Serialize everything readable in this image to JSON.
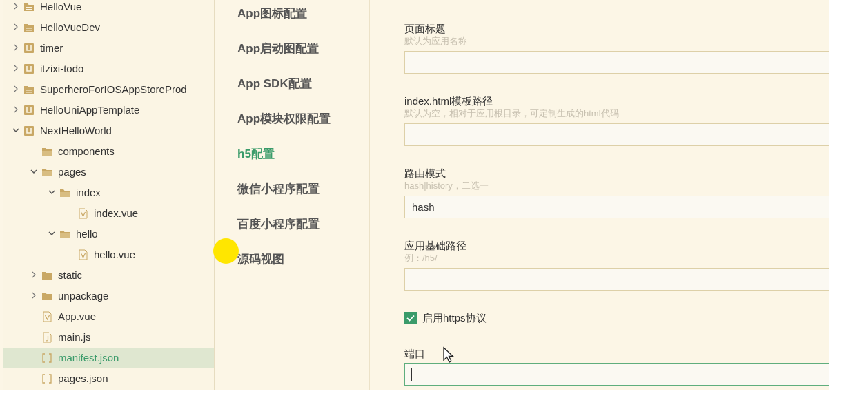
{
  "file_tree": [
    {
      "name": "HelloVue",
      "kind": "folder-lined",
      "expanded": false,
      "selected": false
    },
    {
      "name": "HelloVueDev",
      "kind": "folder-lined",
      "expanded": false,
      "selected": false
    },
    {
      "name": "timer",
      "kind": "project",
      "expanded": false,
      "selected": false
    },
    {
      "name": "itzixi-todo",
      "kind": "project",
      "expanded": false,
      "selected": false
    },
    {
      "name": "SuperheroForIOSAppStoreProd",
      "kind": "folder-lined",
      "expanded": false,
      "selected": false
    },
    {
      "name": "HelloUniAppTemplate",
      "kind": "project",
      "expanded": false,
      "selected": false
    },
    {
      "name": "NextHelloWorld",
      "kind": "project",
      "expanded": true,
      "selected": false,
      "children": [
        {
          "name": "components",
          "kind": "folder-open",
          "selected": false
        },
        {
          "name": "pages",
          "kind": "folder-open",
          "expanded": true,
          "selected": false,
          "children": [
            {
              "name": "index",
              "kind": "folder-open",
              "expanded": true,
              "selected": false,
              "children": [
                {
                  "name": "index.vue",
                  "kind": "vue",
                  "selected": false
                }
              ]
            },
            {
              "name": "hello",
              "kind": "folder-open",
              "expanded": true,
              "selected": false,
              "children": [
                {
                  "name": "hello.vue",
                  "kind": "vue",
                  "selected": false
                }
              ]
            }
          ]
        },
        {
          "name": "static",
          "kind": "folder",
          "expanded": false,
          "selected": false
        },
        {
          "name": "unpackage",
          "kind": "folder",
          "expanded": false,
          "selected": false
        },
        {
          "name": "App.vue",
          "kind": "vue",
          "selected": false
        },
        {
          "name": "main.js",
          "kind": "js",
          "selected": false
        },
        {
          "name": "manifest.json",
          "kind": "json",
          "selected": true
        },
        {
          "name": "pages.json",
          "kind": "json",
          "selected": false
        }
      ]
    }
  ],
  "config_nav": [
    {
      "label": "App图标配置",
      "selected": false
    },
    {
      "label": "App启动图配置",
      "selected": false
    },
    {
      "label": "App SDK配置",
      "selected": false
    },
    {
      "label": "App模块权限配置",
      "selected": false
    },
    {
      "label": "h5配置",
      "selected": true
    },
    {
      "label": "微信小程序配置",
      "selected": false
    },
    {
      "label": "百度小程序配置",
      "selected": false
    },
    {
      "label": "源码视图",
      "selected": false
    }
  ],
  "form_fields": [
    {
      "kind": "text",
      "label": "页面标题",
      "hint": "默认为应用名称",
      "focused": false
    },
    {
      "kind": "text",
      "label": "index.html模板路径",
      "hint": "默认为空，相对于应用根目录，可定制生成的html代码",
      "focused": false
    },
    {
      "kind": "text",
      "label": "路由模式",
      "hint": "hash|history，二选一",
      "value": "hash",
      "focused": false
    },
    {
      "kind": "text",
      "label": "应用基础路径",
      "hint": "例：/h5/",
      "focused": false
    },
    {
      "kind": "checkbox",
      "label": "启用https协议",
      "checked": true
    },
    {
      "kind": "text",
      "label": "端口",
      "focused": true
    }
  ]
}
